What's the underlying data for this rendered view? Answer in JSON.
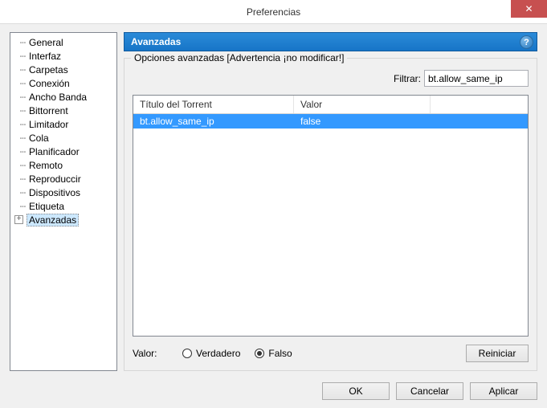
{
  "window": {
    "title": "Preferencias"
  },
  "sidebar": {
    "items": [
      {
        "label": "General"
      },
      {
        "label": "Interfaz"
      },
      {
        "label": "Carpetas"
      },
      {
        "label": "Conexión"
      },
      {
        "label": "Ancho Banda"
      },
      {
        "label": "Bittorrent"
      },
      {
        "label": "Limitador"
      },
      {
        "label": "Cola"
      },
      {
        "label": "Planificador"
      },
      {
        "label": "Remoto"
      },
      {
        "label": "Reproduccir"
      },
      {
        "label": "Dispositivos"
      },
      {
        "label": "Etiqueta"
      },
      {
        "label": "Avanzadas",
        "selected": true,
        "expandable": true
      }
    ]
  },
  "main": {
    "header": "Avanzadas",
    "group_legend": "Opciones avanzadas [Advertencia ¡no modificar!]",
    "filter_label": "Filtrar:",
    "filter_value": "bt.allow_same_ip",
    "columns": {
      "c1": "Título del Torrent",
      "c2": "Valor"
    },
    "rows": [
      {
        "title": "bt.allow_same_ip",
        "value": "false",
        "selected": true
      }
    ],
    "value_label": "Valor:",
    "radio_true": "Verdadero",
    "radio_false": "Falso",
    "radio_selected": "false",
    "reset_btn": "Reiniciar"
  },
  "buttons": {
    "ok": "OK",
    "cancel": "Cancelar",
    "apply": "Aplicar"
  }
}
